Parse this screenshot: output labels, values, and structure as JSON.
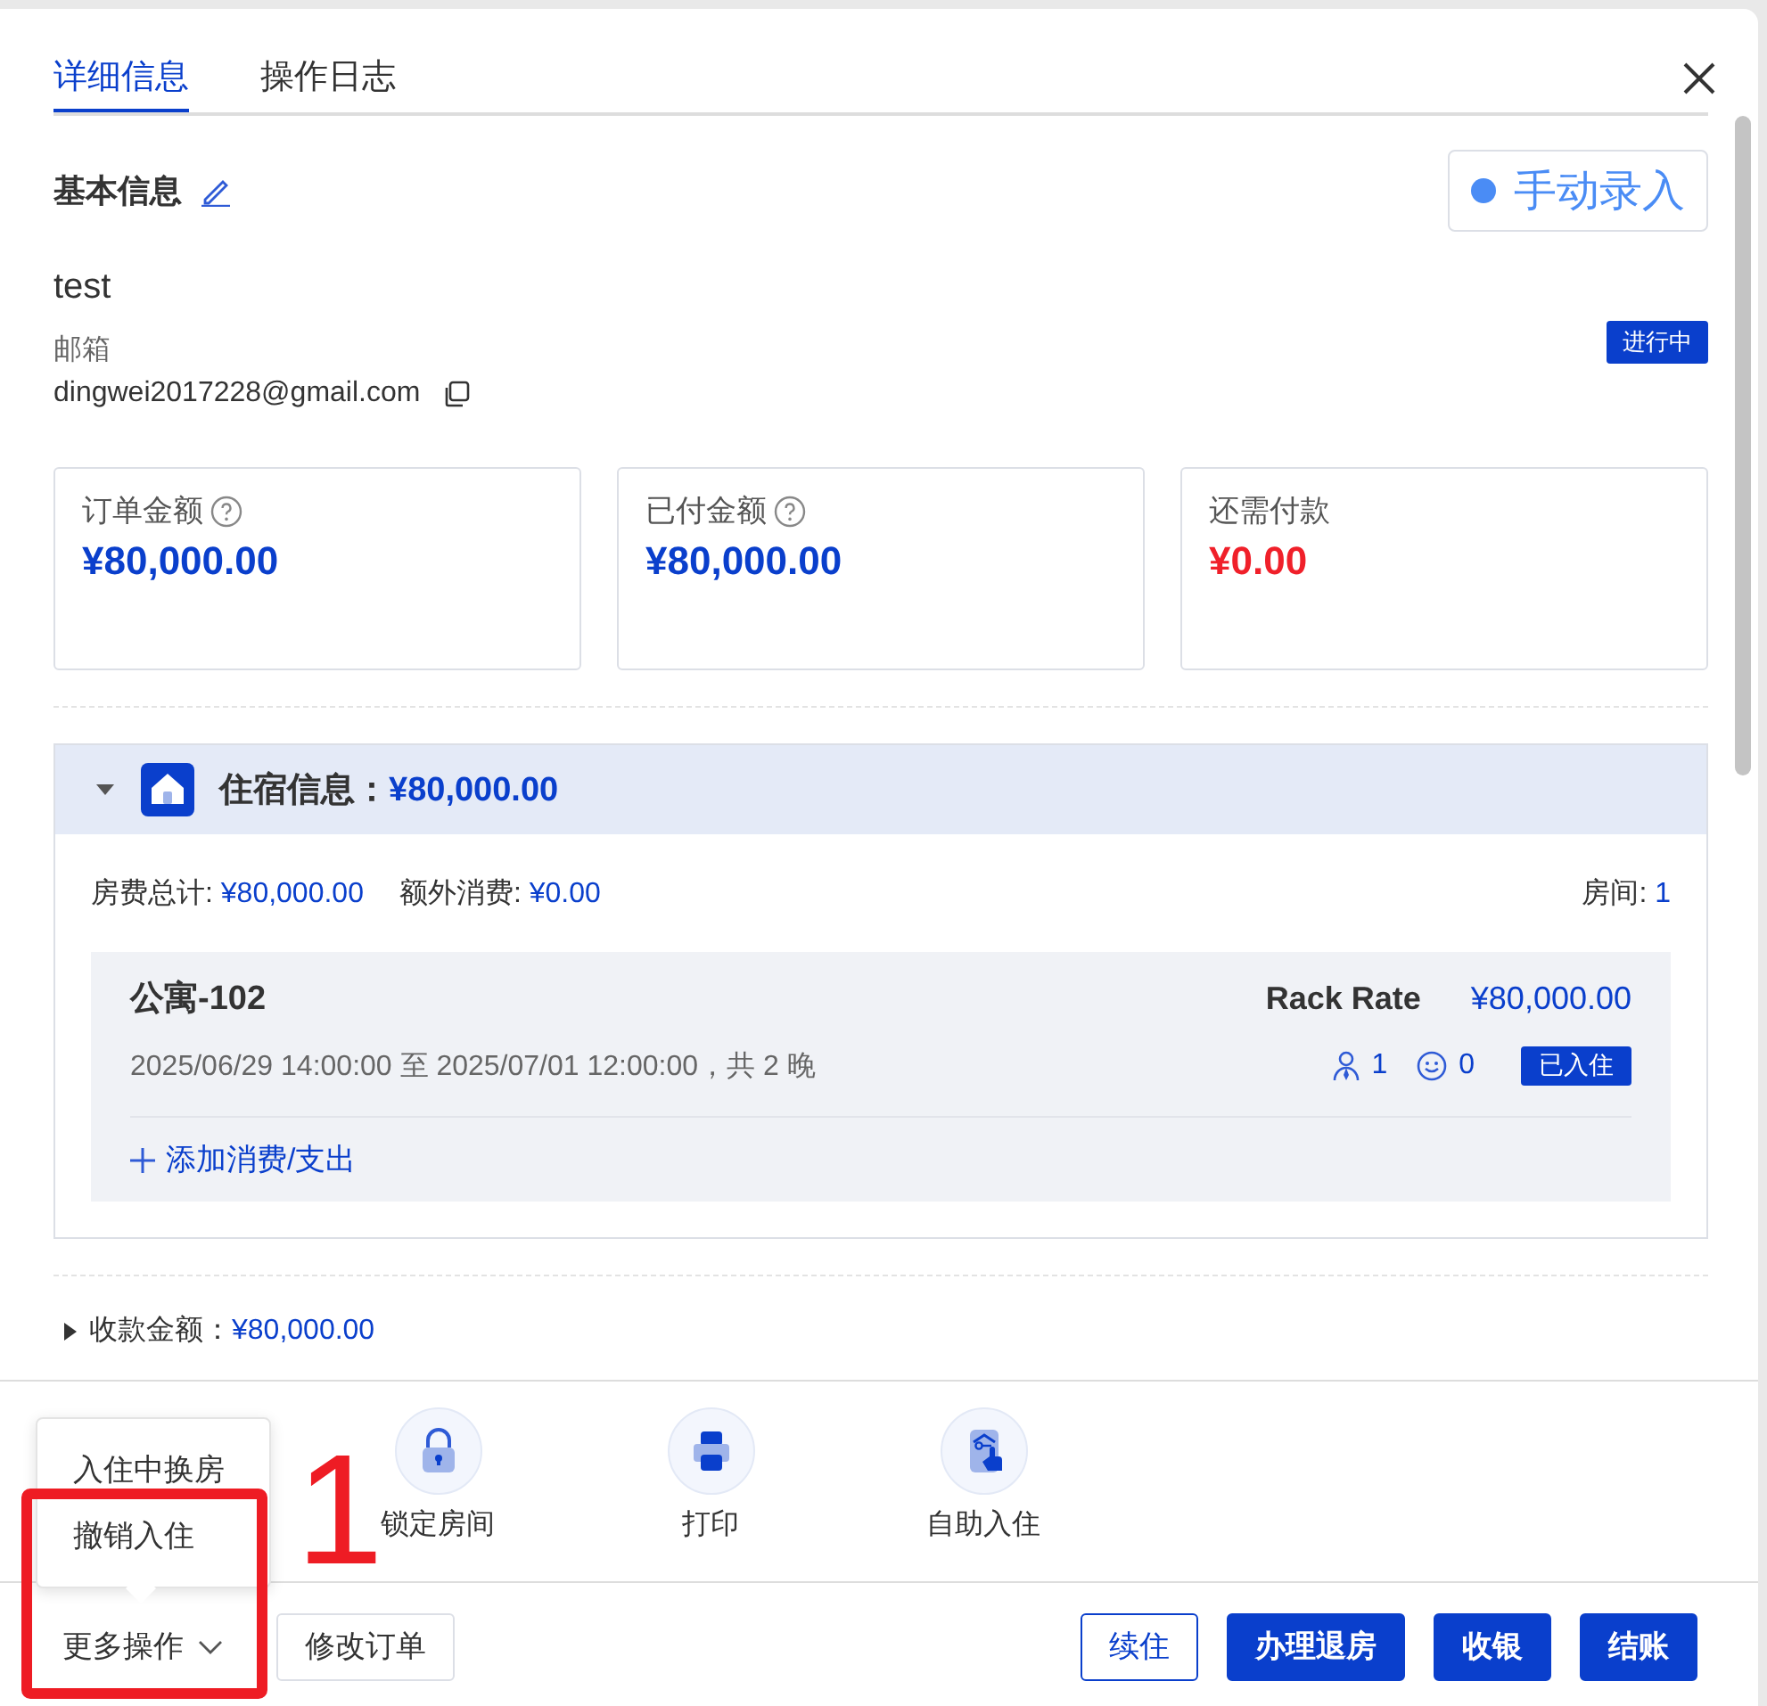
{
  "tabs": [
    {
      "label": "详细信息",
      "selected": true
    },
    {
      "label": "操作日志",
      "selected": false
    }
  ],
  "basic_info": {
    "title": "基本信息",
    "source_button": "手动录入",
    "name": "test",
    "email_label": "邮箱",
    "email": "dingwei2017228@gmail.com",
    "status": "进行中"
  },
  "amounts": [
    {
      "label": "订单金额",
      "help": true,
      "value": "¥80,000.00",
      "color": "#0a3fcc"
    },
    {
      "label": "已付金额",
      "help": true,
      "value": "¥80,000.00",
      "color": "#0a3fcc"
    },
    {
      "label": "还需付款",
      "help": false,
      "value": "¥0.00",
      "color": "#f0202a"
    }
  ],
  "stay": {
    "expanded": true,
    "title": "住宿信息：",
    "total": "¥80,000.00",
    "room_fee_label": "房费总计:",
    "room_fee": "¥80,000.00",
    "extra_label": "额外消费:",
    "extra": "¥0.00",
    "rooms_label": "房间:",
    "rooms_count": "1",
    "rooms": [
      {
        "name": "公寓-102",
        "rate_name": "Rack Rate",
        "rate": "¥80,000.00",
        "dates": "2025/06/29 14:00:00 至 2025/07/01 12:00:00，共 2 晚",
        "adults": "1",
        "children": "0",
        "status": "已入住",
        "add_link": "添加消费/支出"
      }
    ]
  },
  "received": {
    "label": "收款金额：",
    "value": "¥80,000.00"
  },
  "actions": [
    {
      "kind": "lock",
      "label": "锁定房间"
    },
    {
      "kind": "print",
      "label": "打印"
    },
    {
      "kind": "self",
      "label": "自助入住"
    }
  ],
  "more_menu": {
    "open": true,
    "items": [
      "入住中换房",
      "撤销入住"
    ]
  },
  "footer": {
    "more_button": "更多操作",
    "edit_button": "修改订单",
    "buttons": [
      {
        "label": "续住",
        "kind": "outline"
      },
      {
        "label": "办理退房",
        "kind": "primary"
      },
      {
        "label": "收银",
        "kind": "primary"
      },
      {
        "label": "结账",
        "kind": "primary"
      }
    ]
  },
  "annotation": {
    "label": "1"
  }
}
